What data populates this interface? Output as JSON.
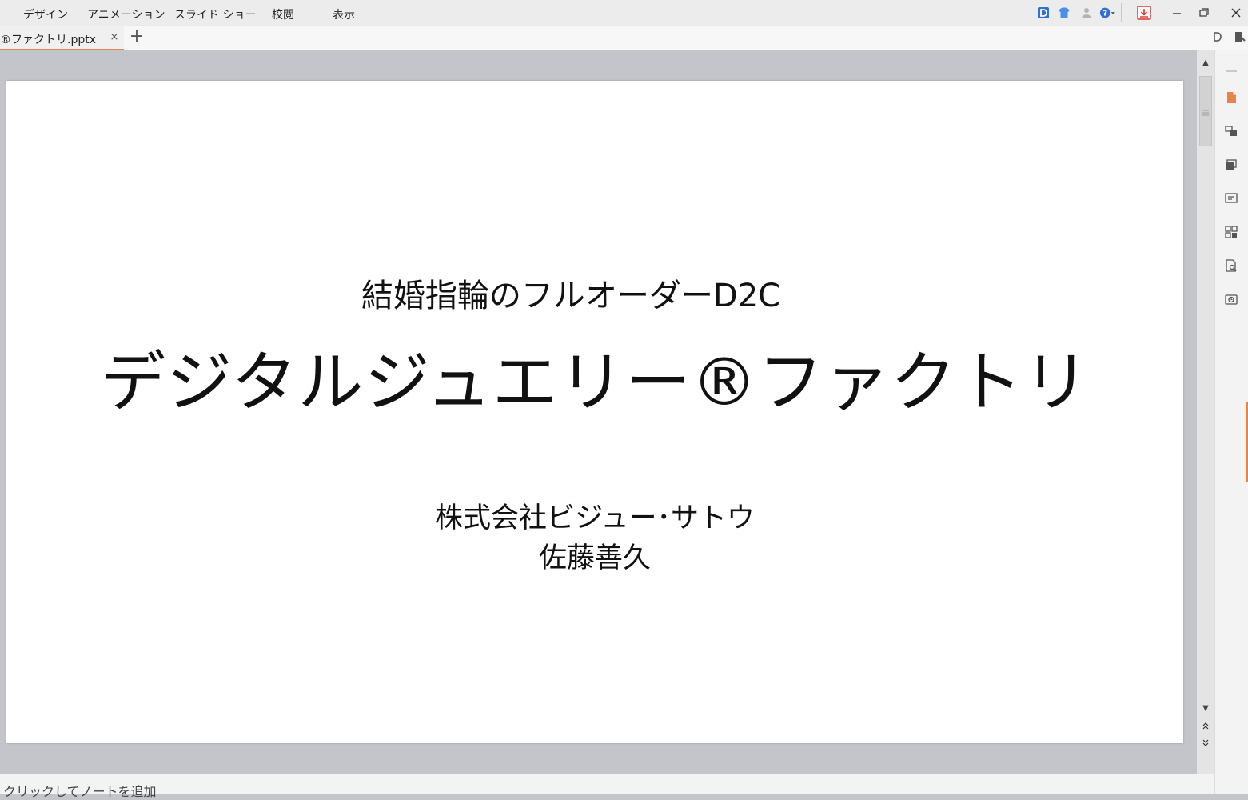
{
  "menu": {
    "items": [
      {
        "label": "デザイン"
      },
      {
        "label": "アニメーション"
      },
      {
        "label": "スライド ショー"
      },
      {
        "label": "校閲"
      },
      {
        "label": "表示"
      }
    ]
  },
  "tabs": {
    "active_label": "®ファクトリ.pptx",
    "close_glyph": "×",
    "new_glyph": "+"
  },
  "slide": {
    "subtitle": "結婚指輪のフルオーダーD2C",
    "title": "デジタルジュエリー®ファクトリ",
    "company": "株式会社ビジュー･サトウ",
    "author": "佐藤善久"
  },
  "notes": {
    "placeholder": "クリックしてノートを追加"
  },
  "colors": {
    "accent": "#e8834c",
    "workspace": "#c3c5cb",
    "icon_blue": "#2f6fd6"
  }
}
